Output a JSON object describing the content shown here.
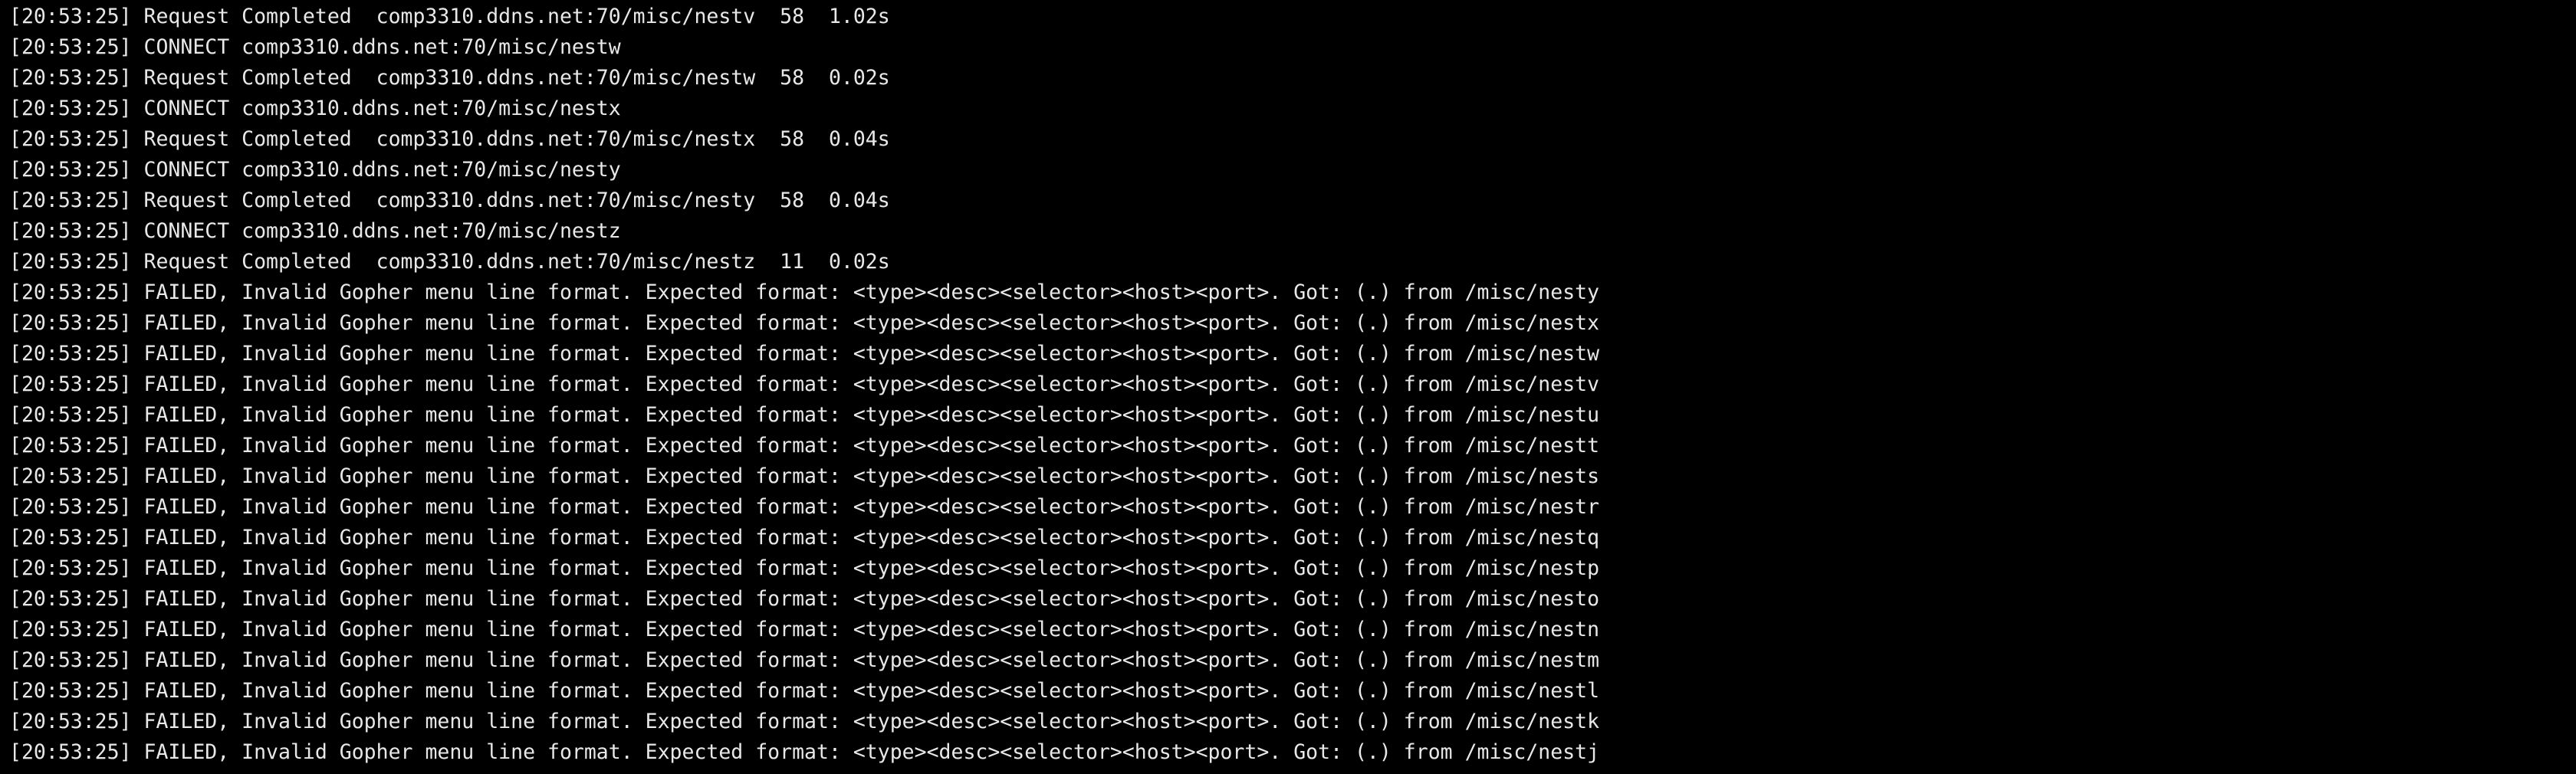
{
  "colors": {
    "background": "#000000",
    "text": "#e8e8e8"
  },
  "terminal": {
    "lines": [
      "[20:53:25] Request Completed  comp3310.ddns.net:70/misc/nestv  58  1.02s",
      "[20:53:25] CONNECT comp3310.ddns.net:70/misc/nestw",
      "[20:53:25] Request Completed  comp3310.ddns.net:70/misc/nestw  58  0.02s",
      "[20:53:25] CONNECT comp3310.ddns.net:70/misc/nestx",
      "[20:53:25] Request Completed  comp3310.ddns.net:70/misc/nestx  58  0.04s",
      "[20:53:25] CONNECT comp3310.ddns.net:70/misc/nesty",
      "[20:53:25] Request Completed  comp3310.ddns.net:70/misc/nesty  58  0.04s",
      "[20:53:25] CONNECT comp3310.ddns.net:70/misc/nestz",
      "[20:53:25] Request Completed  comp3310.ddns.net:70/misc/nestz  11  0.02s",
      "[20:53:25] FAILED, Invalid Gopher menu line format. Expected format: <type><desc><selector><host><port>. Got: (.) from /misc/nesty",
      "[20:53:25] FAILED, Invalid Gopher menu line format. Expected format: <type><desc><selector><host><port>. Got: (.) from /misc/nestx",
      "[20:53:25] FAILED, Invalid Gopher menu line format. Expected format: <type><desc><selector><host><port>. Got: (.) from /misc/nestw",
      "[20:53:25] FAILED, Invalid Gopher menu line format. Expected format: <type><desc><selector><host><port>. Got: (.) from /misc/nestv",
      "[20:53:25] FAILED, Invalid Gopher menu line format. Expected format: <type><desc><selector><host><port>. Got: (.) from /misc/nestu",
      "[20:53:25] FAILED, Invalid Gopher menu line format. Expected format: <type><desc><selector><host><port>. Got: (.) from /misc/nestt",
      "[20:53:25] FAILED, Invalid Gopher menu line format. Expected format: <type><desc><selector><host><port>. Got: (.) from /misc/nests",
      "[20:53:25] FAILED, Invalid Gopher menu line format. Expected format: <type><desc><selector><host><port>. Got: (.) from /misc/nestr",
      "[20:53:25] FAILED, Invalid Gopher menu line format. Expected format: <type><desc><selector><host><port>. Got: (.) from /misc/nestq",
      "[20:53:25] FAILED, Invalid Gopher menu line format. Expected format: <type><desc><selector><host><port>. Got: (.) from /misc/nestp",
      "[20:53:25] FAILED, Invalid Gopher menu line format. Expected format: <type><desc><selector><host><port>. Got: (.) from /misc/nesto",
      "[20:53:25] FAILED, Invalid Gopher menu line format. Expected format: <type><desc><selector><host><port>. Got: (.) from /misc/nestn",
      "[20:53:25] FAILED, Invalid Gopher menu line format. Expected format: <type><desc><selector><host><port>. Got: (.) from /misc/nestm",
      "[20:53:25] FAILED, Invalid Gopher menu line format. Expected format: <type><desc><selector><host><port>. Got: (.) from /misc/nestl",
      "[20:53:25] FAILED, Invalid Gopher menu line format. Expected format: <type><desc><selector><host><port>. Got: (.) from /misc/nestk",
      "[20:53:25] FAILED, Invalid Gopher menu line format. Expected format: <type><desc><selector><host><port>. Got: (.) from /misc/nestj"
    ]
  }
}
